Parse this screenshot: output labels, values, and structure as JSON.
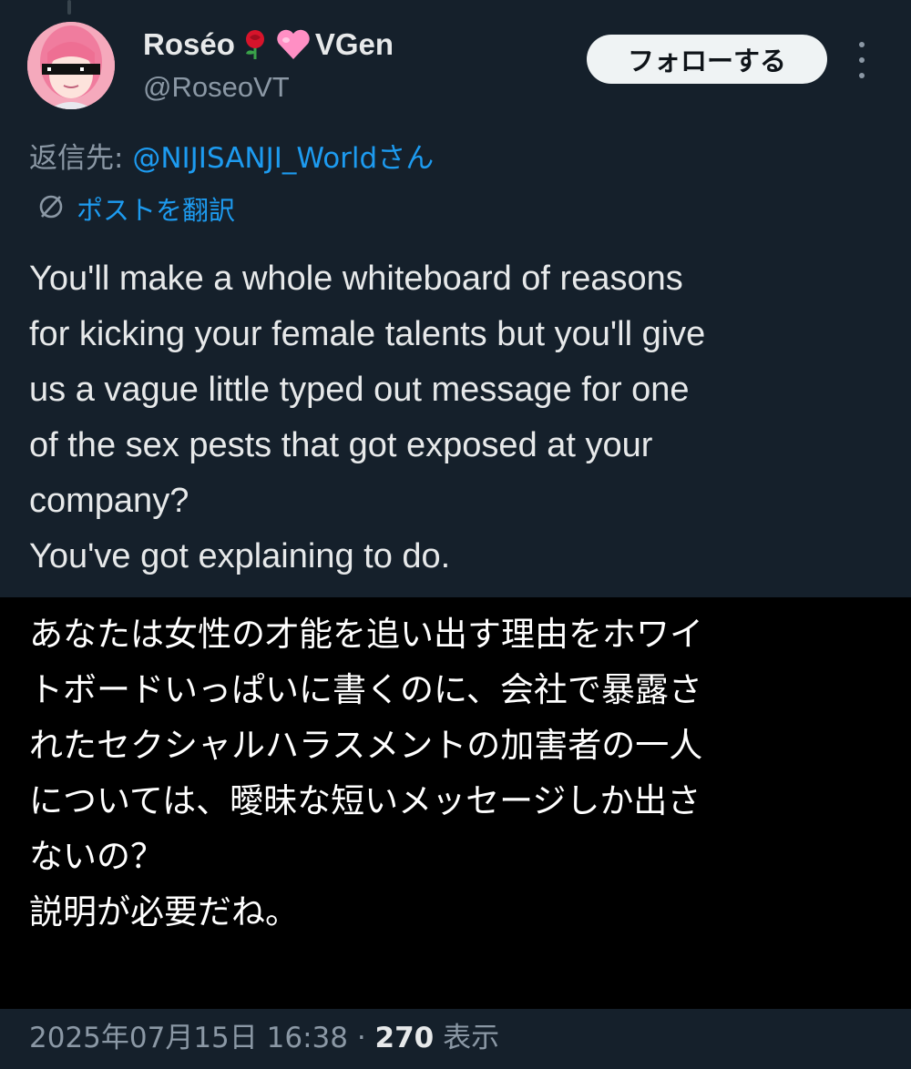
{
  "user": {
    "display_name": "Roséo",
    "display_suffix": "VGen",
    "handle": "@RoseoVT",
    "name_emojis": [
      "rose-icon",
      "pink-heart-icon"
    ]
  },
  "follow_button": {
    "label": "フォローする"
  },
  "more_button": {
    "icon": "more-vertical-icon"
  },
  "reply": {
    "prefix": "返信先: ",
    "mention": "@NIJISANJI_Worldさん"
  },
  "translate": {
    "label": "ポストを翻訳",
    "icon": "globe-translate-icon"
  },
  "tweet": {
    "text_lines": [
      "You'll make a whole whiteboard of reasons",
      "for kicking your female talents but you'll give",
      "us a vague little typed out message for one",
      "of the sex pests that got exposed at your",
      "company?",
      "You've got explaining to do."
    ]
  },
  "translation": {
    "text_lines": [
      "あなたは女性の才能を追い出す理由をホワイ",
      "トボードいっぱいに書くのに、会社で暴露さ",
      "れたセクシャルハラスメントの加害者の一人",
      "については、曖昧な短いメッセージしか出さ",
      "ないの？",
      "説明が必要だね。"
    ]
  },
  "meta": {
    "timestamp": "2025年07月15日 16:38",
    "separator": " · ",
    "views_count": "270",
    "views_label": " 表示"
  },
  "colors": {
    "background": "#15202b",
    "link": "#1d9bf0",
    "secondary_text": "#8b98a5",
    "primary_text": "#e7e9ea"
  }
}
